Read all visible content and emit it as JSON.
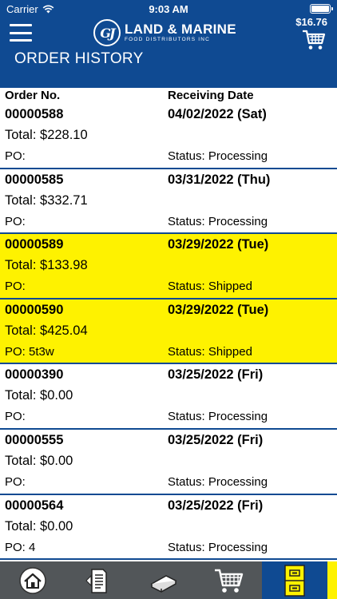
{
  "status_bar": {
    "carrier": "Carrier",
    "time": "9:03 AM"
  },
  "header": {
    "logo_mark": "GJ",
    "logo_name": "LAND & MARINE",
    "logo_sub": "FOOD DISTRIBUTORS INC",
    "cart_total": "$16.76",
    "page_title": "ORDER HISTORY"
  },
  "columns": {
    "order_no": "Order No.",
    "receiving_date": "Receiving Date"
  },
  "orders": [
    {
      "number": "00000588",
      "date": "04/02/2022 (Sat)",
      "total": "Total: $228.10",
      "po": "PO:",
      "status": "Status: Processing",
      "highlight": false
    },
    {
      "number": "00000585",
      "date": "03/31/2022 (Thu)",
      "total": "Total: $332.71",
      "po": "PO:",
      "status": "Status: Processing",
      "highlight": false
    },
    {
      "number": "00000589",
      "date": "03/29/2022 (Tue)",
      "total": "Total: $133.98",
      "po": "PO:",
      "status": "Status: Shipped",
      "highlight": true
    },
    {
      "number": "00000590",
      "date": "03/29/2022 (Tue)",
      "total": "Total: $425.04",
      "po": "PO: 5t3w",
      "status": "Status: Shipped",
      "highlight": true
    },
    {
      "number": "00000390",
      "date": "03/25/2022 (Fri)",
      "total": "Total: $0.00",
      "po": "PO:",
      "status": "Status: Processing",
      "highlight": false
    },
    {
      "number": "00000555",
      "date": "03/25/2022 (Fri)",
      "total": "Total: $0.00",
      "po": "PO:",
      "status": "Status: Processing",
      "highlight": false
    },
    {
      "number": "00000564",
      "date": "03/25/2022 (Fri)",
      "total": "Total: $0.00",
      "po": "PO: 4",
      "status": "Status: Processing",
      "highlight": false
    }
  ],
  "tabbar": {
    "tabs": [
      {
        "icon": "home-icon",
        "active": false
      },
      {
        "icon": "order-form-icon",
        "active": false
      },
      {
        "icon": "catalog-book-icon",
        "active": false
      },
      {
        "icon": "shopping-cart-icon",
        "active": false
      },
      {
        "icon": "order-history-cabinet-icon",
        "active": true
      }
    ]
  },
  "colors": {
    "brand_blue": "#0f4a92",
    "highlight_yellow": "#fef200",
    "tabbar_gray": "#525659"
  }
}
